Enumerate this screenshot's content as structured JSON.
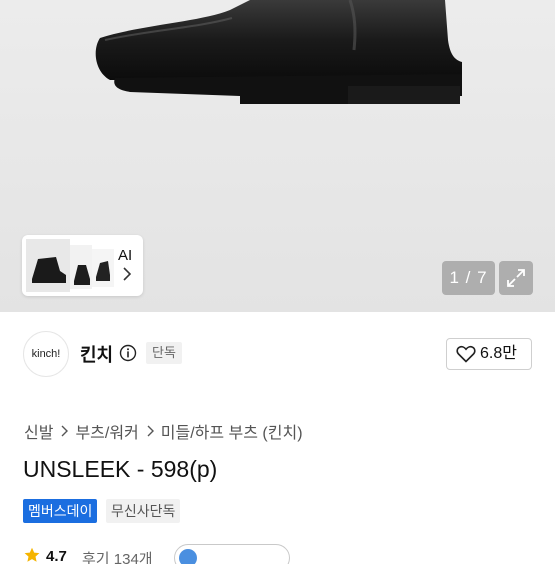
{
  "gallery": {
    "ai_label": "AI",
    "page_indicator": "1 / 7"
  },
  "brand": {
    "logo_text": "kinch!",
    "name": "킨치",
    "exclusive_badge": "단독",
    "like_count": "6.8만"
  },
  "breadcrumb": [
    "신발",
    "부츠/워커",
    "미들/하프 부츠 (킨치)"
  ],
  "product": {
    "title": "UNSLEEK - 598(p)",
    "badges": {
      "member_day": "멤버스데이",
      "musinsa_exclusive": "무신사단독"
    },
    "rating": "4.7",
    "review_count": "후기 134개"
  },
  "colors": {
    "member_badge": "#1b6ee0",
    "chip_icon": "#4a8fe0"
  },
  "icons": [
    "info-icon",
    "heart-icon",
    "chevron-right-icon",
    "expand-icon",
    "star-icon"
  ]
}
